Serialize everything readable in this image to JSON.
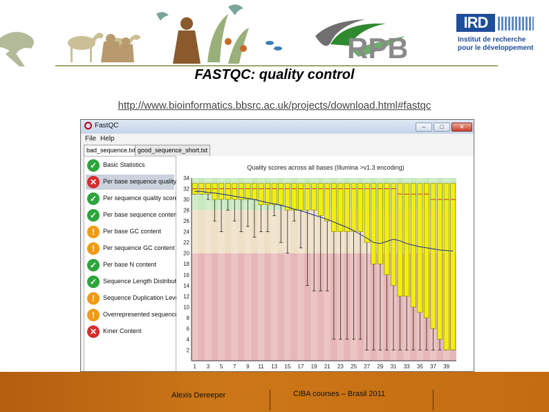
{
  "slide": {
    "title": "FASTQC: quality control",
    "url": "http://www.bioinformatics.bbsrc.ac.uk/projects/download.html#fastqc",
    "logo_rpb": "RPB",
    "logo_ird": "IRD",
    "ird_tagline_1": "Institut de recherche",
    "ird_tagline_2": "pour le développement"
  },
  "window": {
    "title": "FastQC",
    "controls": {
      "minimize": "–",
      "maximize": "□",
      "close": "✕"
    },
    "menu": [
      "File",
      "Help"
    ],
    "tabs": [
      "bad_sequence.txt",
      "good_sequence_short.txt"
    ],
    "active_tab": 0
  },
  "modules": [
    {
      "label": "Basic Statistics",
      "status": "pass",
      "icon": "check-icon"
    },
    {
      "label": "Per base sequence quality",
      "status": "fail",
      "icon": "cross-icon",
      "selected": true
    },
    {
      "label": "Per sequence quality scores",
      "status": "pass",
      "icon": "check-icon"
    },
    {
      "label": "Per base sequence content",
      "status": "pass",
      "icon": "check-icon"
    },
    {
      "label": "Per base GC content",
      "status": "warn",
      "icon": "exclamation-icon"
    },
    {
      "label": "Per sequence GC content",
      "status": "warn",
      "icon": "exclamation-icon"
    },
    {
      "label": "Per base N content",
      "status": "pass",
      "icon": "check-icon"
    },
    {
      "label": "Sequence Length Distribution",
      "status": "pass",
      "icon": "check-icon"
    },
    {
      "label": "Sequence Duplication Levels",
      "status": "warn",
      "icon": "exclamation-icon"
    },
    {
      "label": "Overrepresented sequences",
      "status": "warn",
      "icon": "exclamation-icon"
    },
    {
      "label": "Kmer Content",
      "status": "fail",
      "icon": "cross-icon"
    }
  ],
  "footer": {
    "author": "Alexis Dereeper",
    "course": "CIBA courses – Brasil 2011"
  },
  "colors": {
    "pass": "#2ea43c",
    "warn": "#f29a12",
    "fail": "#d52d2d",
    "zone_good": "#c9e9c0",
    "zone_mid": "#eee0c6",
    "zone_bad": "#e7b7b7",
    "box_fill": "#f2ee10",
    "box_stroke": "#7a7a00",
    "median": "#d03030",
    "mean": "#1d2a8a"
  },
  "chart_data": {
    "type": "box",
    "title": "Quality scores across all bases (Illumina >v1.3 encoding)",
    "xlabel": "",
    "ylabel": "",
    "ylim": [
      0,
      34
    ],
    "y_ticks": [
      2,
      4,
      6,
      8,
      10,
      12,
      14,
      16,
      18,
      20,
      22,
      24,
      26,
      28,
      30,
      32,
      34
    ],
    "x_ticks": [
      "1",
      "3",
      "5",
      "7",
      "9",
      "11",
      "13",
      "15",
      "17",
      "19",
      "21",
      "23",
      "25",
      "27",
      "29",
      "31",
      "33",
      "35",
      "37",
      "39"
    ],
    "zones": [
      {
        "name": "good",
        "from": 28,
        "to": 34
      },
      {
        "name": "reasonable",
        "from": 20,
        "to": 28
      },
      {
        "name": "poor",
        "from": 0,
        "to": 20
      }
    ],
    "positions": [
      1,
      2,
      3,
      4,
      5,
      6,
      7,
      8,
      9,
      10,
      11,
      12,
      13,
      14,
      15,
      16,
      17,
      18,
      19,
      20,
      21,
      22,
      23,
      24,
      25,
      26,
      27,
      28,
      29,
      30,
      31,
      32,
      33,
      34,
      35,
      36,
      37,
      38,
      39,
      40
    ],
    "median": [
      32,
      32,
      32,
      32,
      32,
      32,
      32,
      32,
      32,
      32,
      32,
      32,
      32,
      32,
      32,
      32,
      32,
      32,
      32,
      32,
      32,
      32,
      32,
      32,
      32,
      32,
      32,
      32,
      32,
      32,
      32,
      31,
      31,
      31,
      31,
      31,
      30,
      30,
      30,
      30
    ],
    "q1": [
      31,
      31,
      31,
      30,
      30,
      30,
      30,
      30,
      30,
      30,
      29,
      29,
      29,
      29,
      28,
      28,
      28,
      28,
      28,
      27,
      26,
      24,
      24,
      24,
      24,
      24,
      22,
      18,
      18,
      16,
      14,
      12,
      12,
      10,
      9,
      8,
      6,
      4,
      2,
      2
    ],
    "q3": [
      33,
      33,
      33,
      33,
      33,
      33,
      33,
      33,
      33,
      33,
      33,
      33,
      33,
      33,
      33,
      33,
      33,
      33,
      33,
      33,
      33,
      33,
      33,
      33,
      33,
      33,
      33,
      33,
      33,
      33,
      33,
      33,
      33,
      33,
      33,
      33,
      33,
      33,
      33,
      33
    ],
    "low": [
      31,
      31,
      30,
      26,
      24,
      28,
      26,
      24,
      25,
      23,
      24,
      24,
      27,
      22,
      20,
      26,
      21,
      14,
      13,
      13,
      13,
      4,
      4,
      4,
      4,
      4,
      2,
      2,
      2,
      2,
      2,
      2,
      2,
      2,
      2,
      2,
      2,
      2,
      2,
      2
    ],
    "high": [
      33,
      33,
      33,
      33,
      33,
      33,
      33,
      33,
      33,
      33,
      33,
      33,
      33,
      33,
      33,
      33,
      33,
      33,
      33,
      33,
      33,
      33,
      33,
      33,
      33,
      33,
      33,
      33,
      33,
      33,
      33,
      33,
      33,
      33,
      33,
      33,
      33,
      33,
      33,
      33
    ],
    "mean": [
      31.5,
      31.5,
      31.3,
      31.2,
      31.0,
      30.8,
      30.6,
      30.4,
      30.2,
      30.0,
      29.7,
      29.4,
      29.2,
      28.9,
      28.6,
      28.2,
      27.9,
      27.5,
      27.1,
      26.7,
      26.3,
      25.8,
      25.3,
      24.8,
      24.2,
      23.5,
      22.8,
      22.0,
      21.8,
      22.2,
      22.6,
      22.3,
      21.8,
      21.5,
      21.2,
      21.0,
      20.8,
      20.6,
      20.5,
      20.4
    ]
  }
}
